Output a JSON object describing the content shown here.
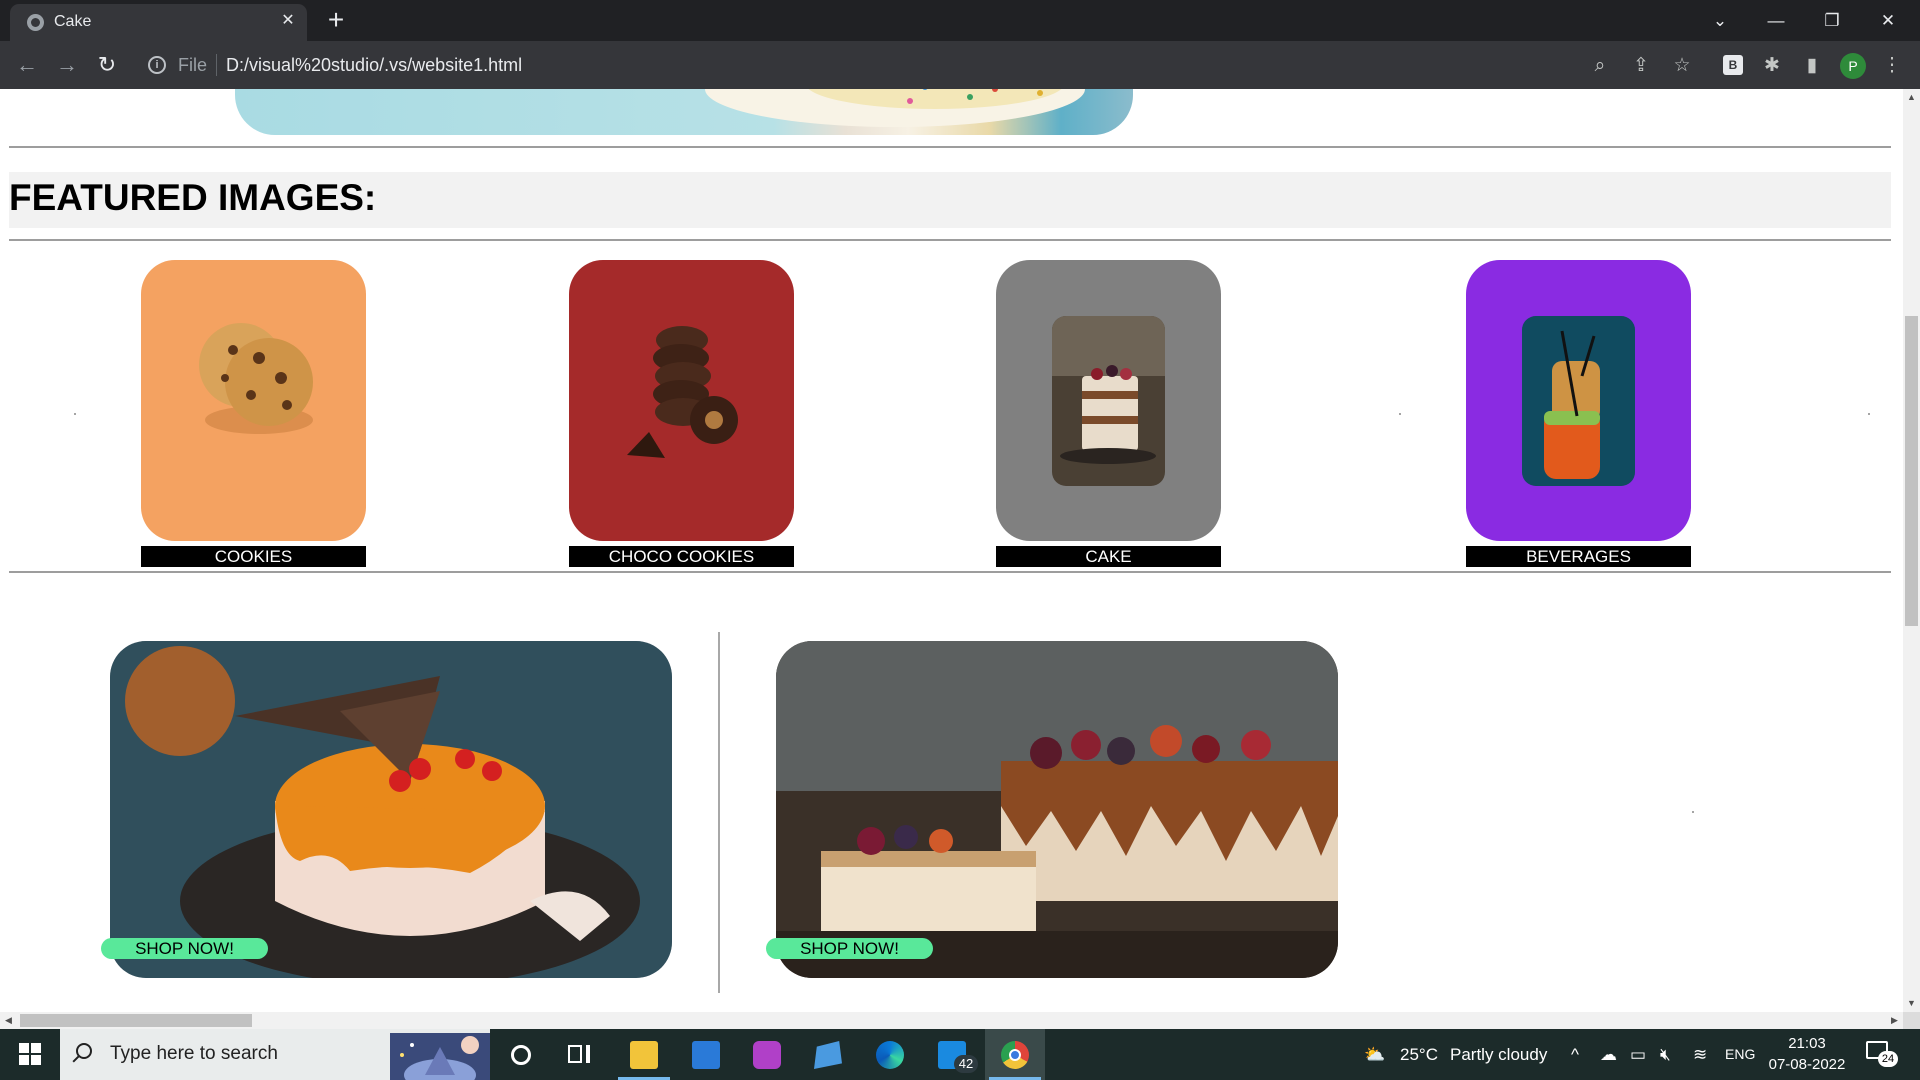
{
  "browser": {
    "tab_title": "Cake",
    "url_scheme": "File",
    "url": "D:/visual%20studio/.vs/website1.html",
    "icons": [
      "back-icon",
      "forward-icon",
      "reload-icon",
      "info-icon",
      "zoom-icon",
      "share-icon",
      "star-icon",
      "extension-b-icon",
      "puzzle-icon",
      "sidebar-icon",
      "profile-icon",
      "menu-icon"
    ],
    "extension_label": "B",
    "profile_initial": "P"
  },
  "page": {
    "featured_heading": "FEATURED IMAGES:",
    "cards": [
      {
        "label": "COOKIES",
        "bg": "#f4a261"
      },
      {
        "label": "CHOCO COOKIES",
        "bg": "#a52a2a"
      },
      {
        "label": "CAKE",
        "bg": "#808080"
      },
      {
        "label": "BEVERAGES",
        "bg": "#8a2be2"
      }
    ],
    "promos": [
      {
        "button": "SHOP NOW!"
      },
      {
        "button": "SHOP NOW!"
      }
    ],
    "accent_button_color": "#59e89a"
  },
  "taskbar": {
    "search_placeholder": "Type here to search",
    "mail_badge": "42",
    "weather_temp": "25°C",
    "weather_text": "Partly cloudy",
    "language": "ENG",
    "time": "21:03",
    "date": "07-08-2022",
    "notification_count": "24"
  }
}
